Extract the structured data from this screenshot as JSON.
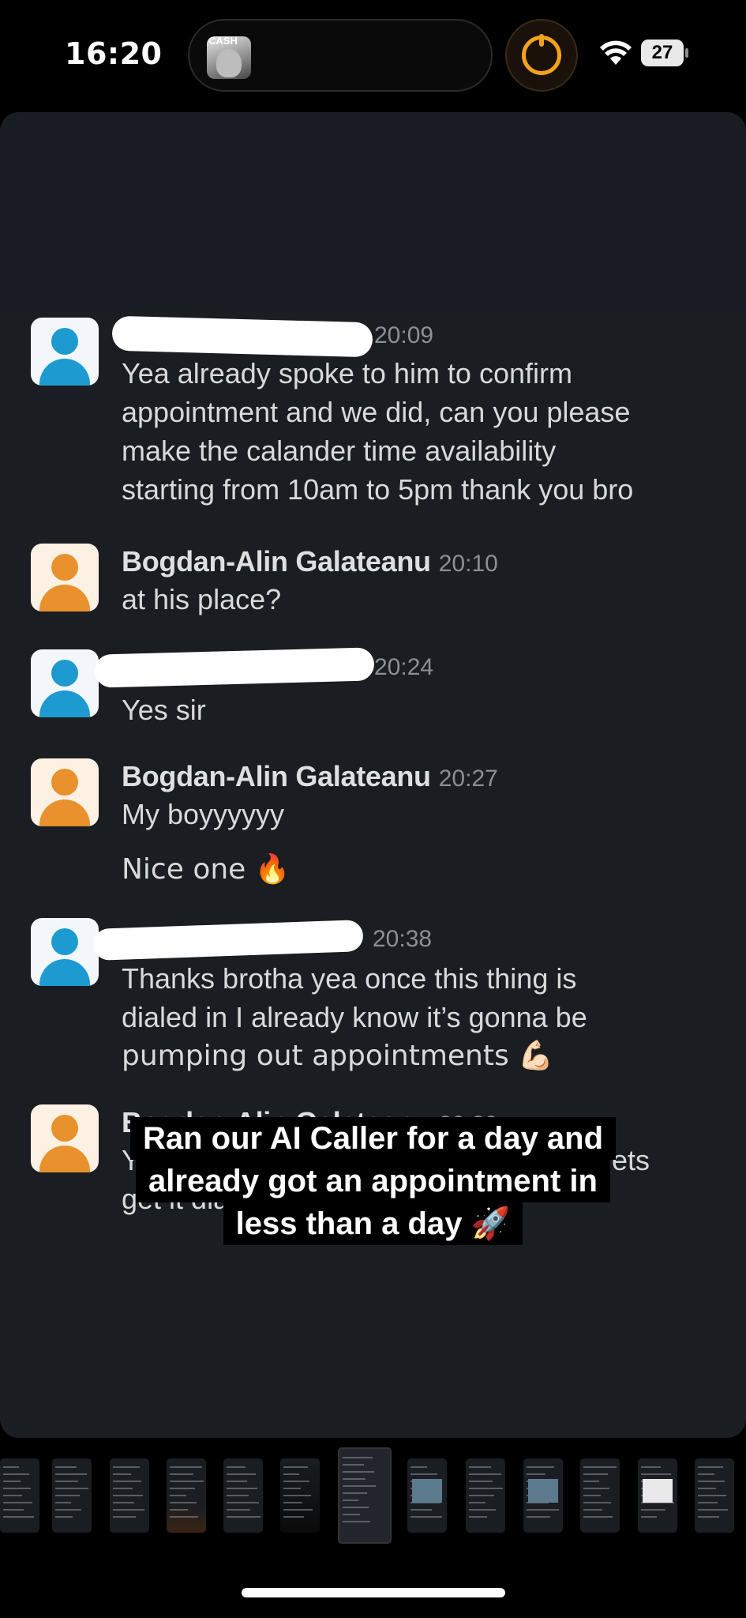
{
  "status_bar": {
    "time": "16:20",
    "island_thumb_label": "CASH",
    "battery": "27",
    "icons": [
      "timer-icon",
      "wifi-icon",
      "battery-icon"
    ],
    "accent_color": "#f3a31a"
  },
  "messages": [
    {
      "sender": "",
      "sender_redacted": true,
      "time": "20:09",
      "avatar": "blue",
      "lines": [
        "Yea already spoke to him to confirm",
        "appointment and we did, can you please",
        "make the calander time availability",
        "starting from 10am to 5pm thank you bro"
      ]
    },
    {
      "sender": "Bogdan-Alin Galateanu",
      "sender_redacted": false,
      "time": "20:10",
      "avatar": "orange",
      "lines": [
        "at his place?"
      ]
    },
    {
      "sender": "",
      "sender_redacted": true,
      "time": "20:24",
      "avatar": "blue",
      "lines": [
        "Yes sir"
      ]
    },
    {
      "sender": "Bogdan-Alin Galateanu",
      "sender_redacted": false,
      "time": "20:27",
      "avatar": "orange",
      "lines": [
        "My boyyyyyy"
      ],
      "extra": "Nice one 🔥"
    },
    {
      "sender": "",
      "sender_redacted": true,
      "time": "20:38",
      "avatar": "blue",
      "lines": [
        "Thanks brotha yea once this thing is",
        "dialed in I already know it’s gonna be",
        "pumping out appointments 💪🏻"
      ]
    },
    {
      "sender": "Bogdan-Alin Galateanu",
      "sender_redacted": false,
      "time": "20:39",
      "avatar": "orange",
      "lines": [
        "Yessir I mean that was pretty quick so lets",
        "get it dialled in"
      ]
    }
  ],
  "caption": {
    "lines": [
      "Ran our AI Caller for a day and",
      "already got an  appointment in",
      "less than a day 🚀"
    ]
  },
  "thumbnails": {
    "count": 13,
    "selected_index": 6
  },
  "colors": {
    "sheet": "#1a1d21",
    "avatar_blue": "#1d9bd1",
    "avatar_orange": "#e8912d"
  }
}
